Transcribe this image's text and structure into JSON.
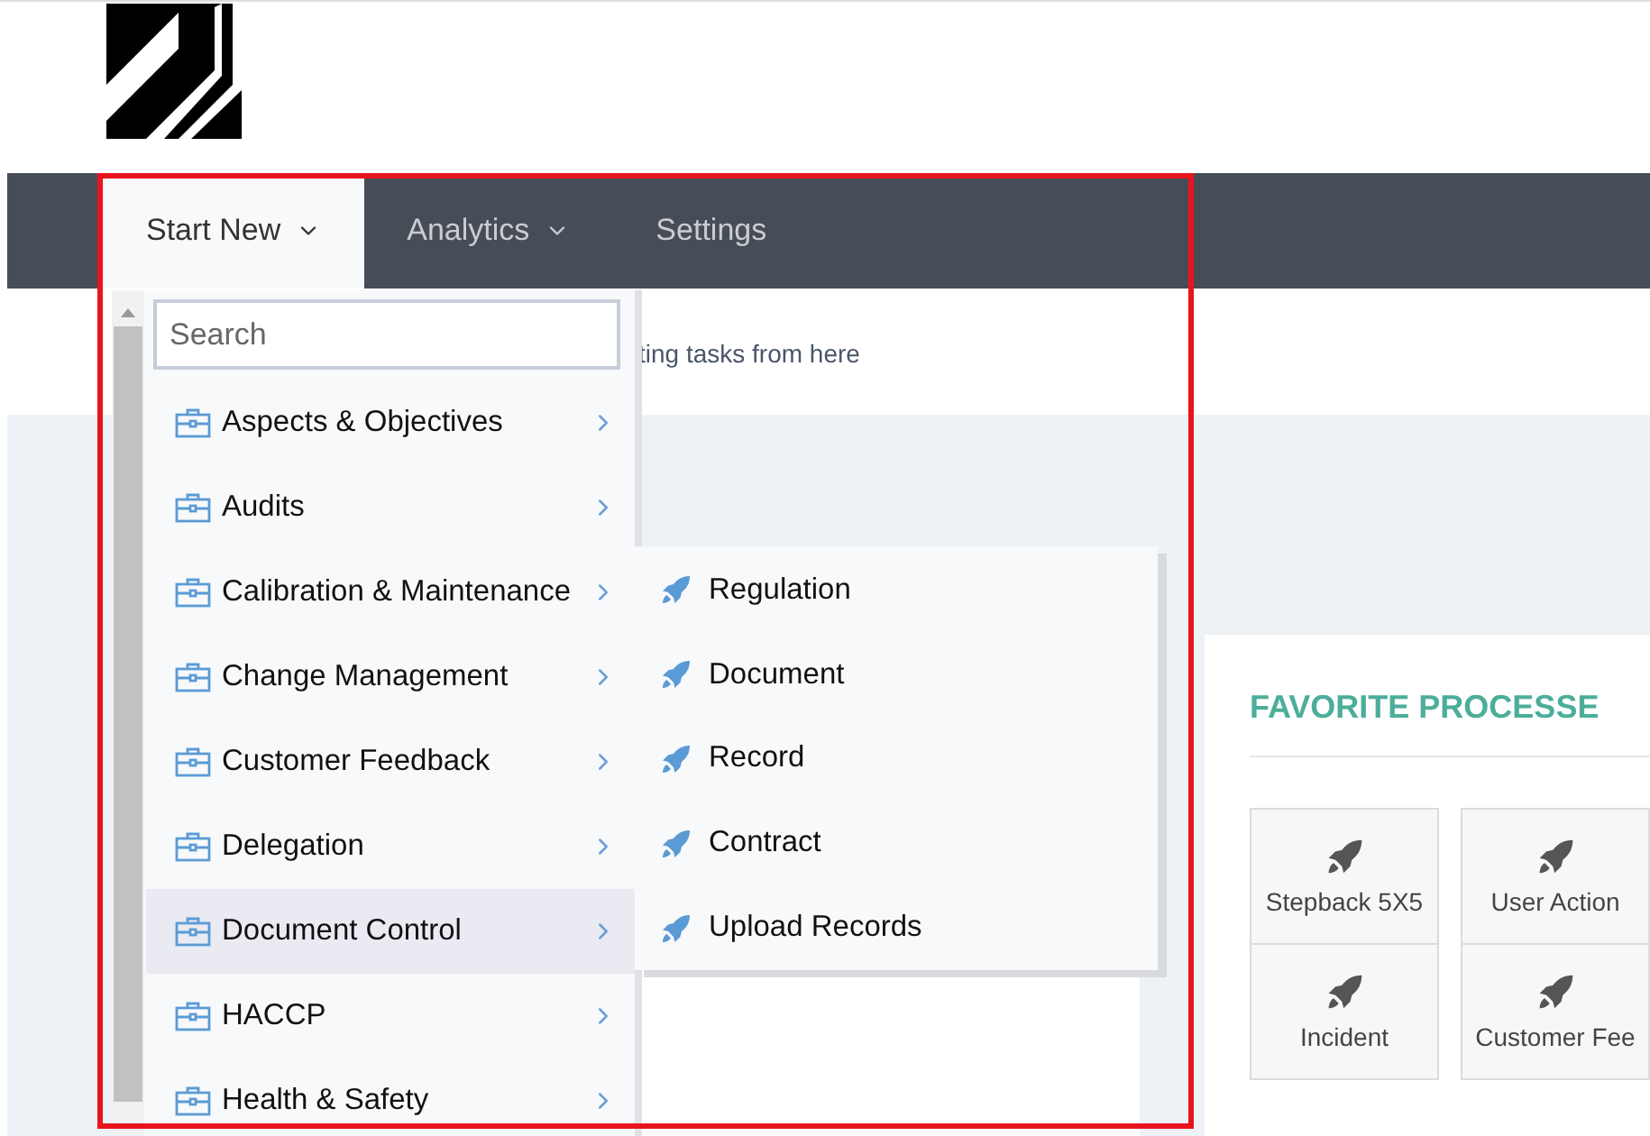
{
  "nav": {
    "tabs": [
      {
        "label": "Start New",
        "selected": true,
        "has_dropdown": true
      },
      {
        "label": "Analytics",
        "selected": false,
        "has_dropdown": true
      },
      {
        "label": "Settings",
        "selected": false,
        "has_dropdown": false
      }
    ]
  },
  "intro_text": "ting tasks from here",
  "favorites": {
    "title": "FAVORITE PROCESSE",
    "rows": [
      [
        "Stepback 5X5",
        "User Action"
      ],
      [
        "Incident",
        "Customer Fee"
      ]
    ]
  },
  "start_menu": {
    "search": {
      "placeholder": "Search"
    },
    "items": [
      {
        "label": "Aspects & Objectives",
        "selected": false
      },
      {
        "label": "Audits",
        "selected": false
      },
      {
        "label": "Calibration & Maintenance",
        "selected": false
      },
      {
        "label": "Change Management",
        "selected": false
      },
      {
        "label": "Customer Feedback",
        "selected": false
      },
      {
        "label": "Delegation",
        "selected": false
      },
      {
        "label": "Document Control",
        "selected": true
      },
      {
        "label": "HACCP",
        "selected": false
      },
      {
        "label": "Health & Safety",
        "selected": false
      }
    ],
    "submenu": {
      "items": [
        "Regulation",
        "Document",
        "Record",
        "Contract",
        "Upload Records"
      ]
    }
  }
}
